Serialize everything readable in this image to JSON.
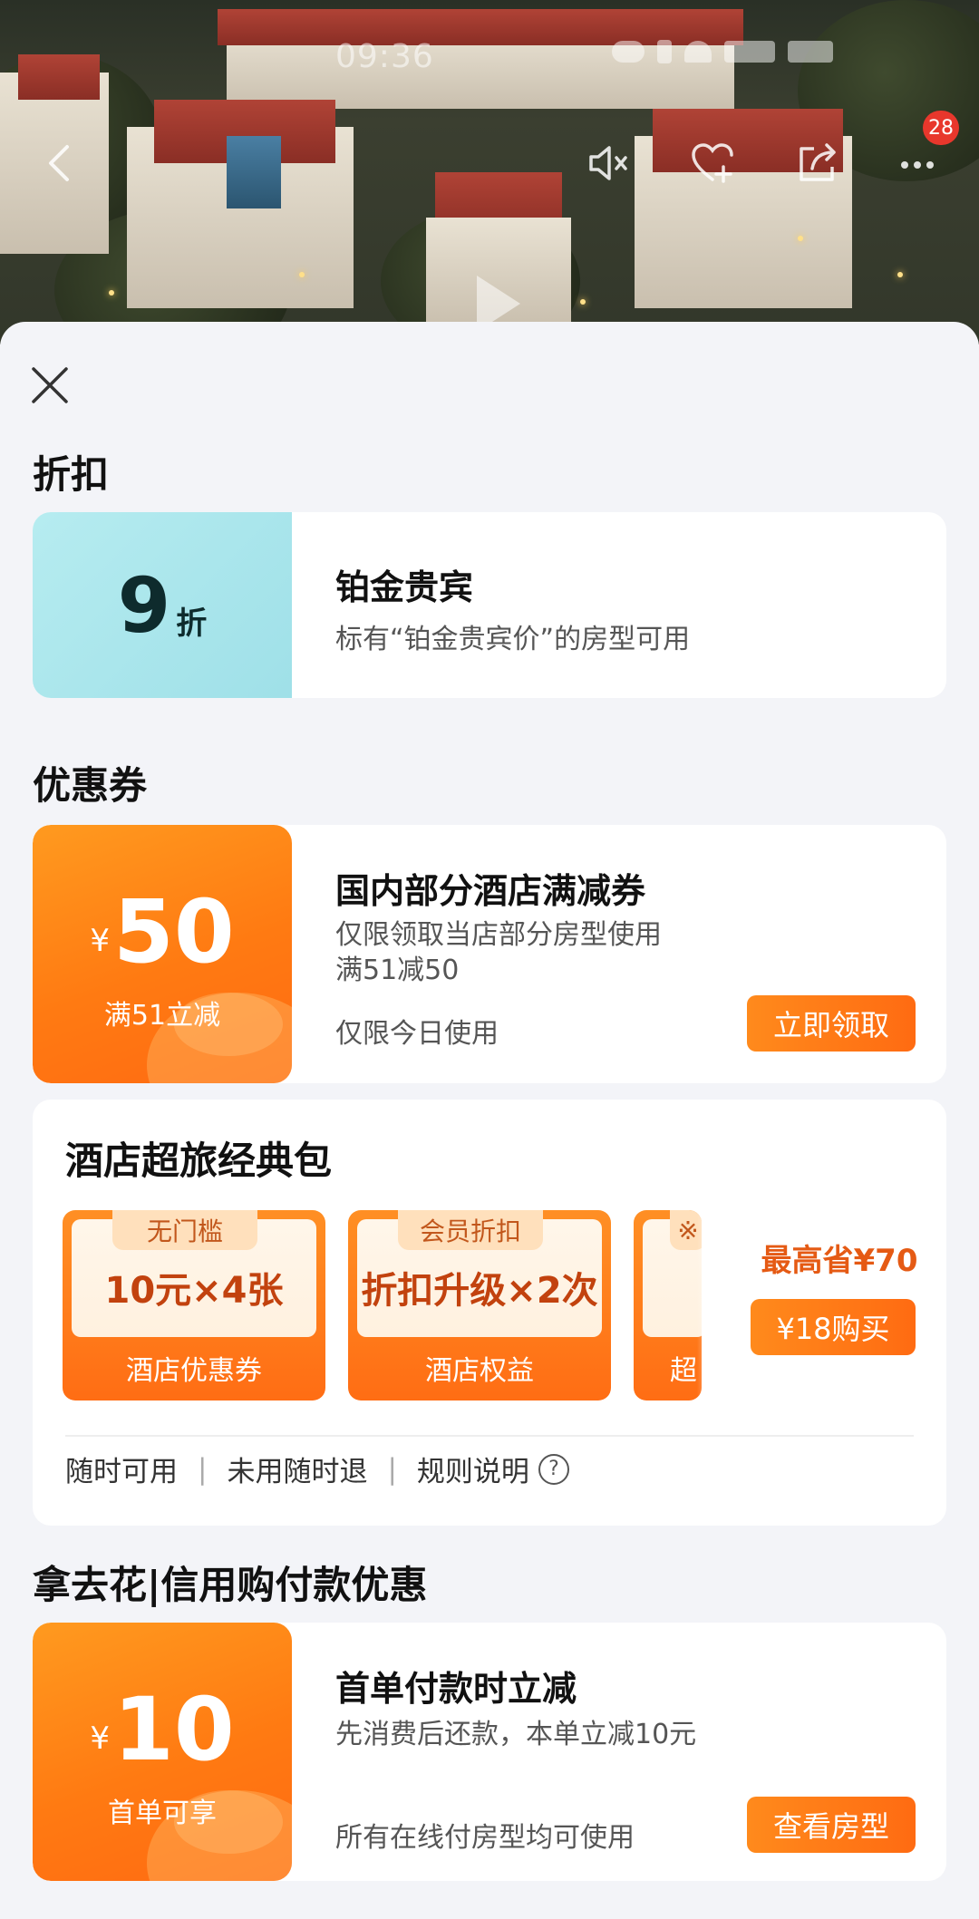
{
  "status_bar": {
    "time": "09:36"
  },
  "hero": {
    "notification_count": "28"
  },
  "discount_section": {
    "title": "折扣",
    "card": {
      "value": "9",
      "unit": "折",
      "title": "铂金贵宾",
      "desc": "标有“铂金贵宾价”的房型可用"
    }
  },
  "coupon_section": {
    "title": "优惠券",
    "coupon": {
      "currency": "¥",
      "amount": "50",
      "condition": "满51立减",
      "title": "国内部分酒店满减券",
      "desc1": "仅限领取当店部分房型使用",
      "desc2": "满51减50",
      "validity": "仅限今日使用",
      "button": "立即领取"
    }
  },
  "package": {
    "title": "酒店超旅经典包",
    "items": [
      {
        "tag": "无门槛",
        "main": "10元×4张",
        "foot": "酒店优惠券"
      },
      {
        "tag": "会员折扣",
        "main": "折扣升级×2次",
        "foot": "酒店权益"
      },
      {
        "tag": "※",
        "main": "",
        "foot": "超"
      }
    ],
    "save_text": "最高省¥70",
    "buy_button": "¥18购买",
    "links": [
      "随时可用",
      "未用随时退",
      "规则说明"
    ],
    "separator": "|",
    "help_symbol": "?"
  },
  "credit_section": {
    "title": "拿去花|信用购付款优惠",
    "offer": {
      "currency": "¥",
      "amount": "10",
      "condition": "首单可享",
      "title": "首单付款时立减",
      "desc": "先消费后还款，本单立减10元",
      "scope": "所有在线付房型均可使用",
      "button": "查看房型"
    }
  }
}
